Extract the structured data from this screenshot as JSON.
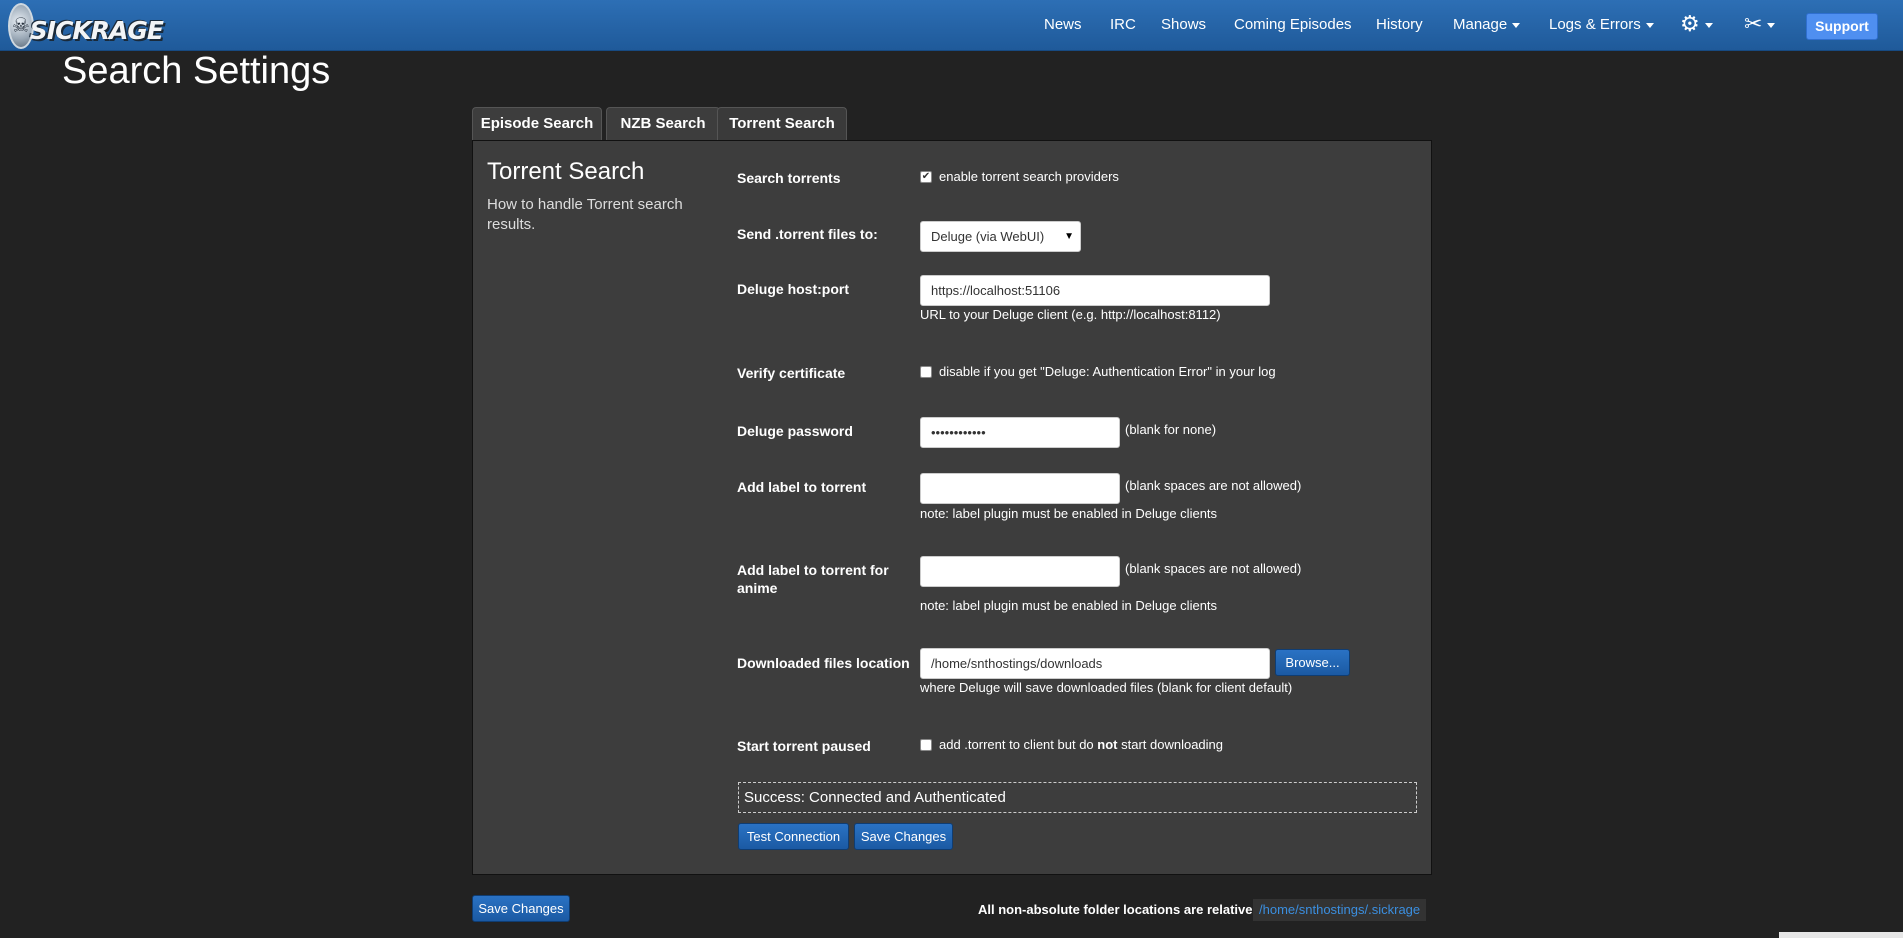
{
  "app": {
    "logo_text": "SICKRAGE",
    "page_title": "Search Settings"
  },
  "nav": {
    "items": [
      "News",
      "IRC",
      "Shows",
      "Coming Episodes",
      "History",
      "Manage",
      "Logs & Errors"
    ],
    "support": "Support",
    "icons": [
      "gear-icon",
      "tools-icon"
    ]
  },
  "tabs": [
    "Episode Search",
    "NZB Search",
    "Torrent Search"
  ],
  "section": {
    "title": "Torrent Search",
    "description": "How to handle Torrent search results."
  },
  "fields": {
    "search_torrents": {
      "label": "Search torrents",
      "checkbox_label": "enable torrent search providers",
      "checked": true
    },
    "send_to": {
      "label": "Send .torrent files to:",
      "value": "Deluge (via WebUI)"
    },
    "host": {
      "label": "Deluge host:port",
      "value": "https://localhost:51106",
      "help": "URL to your Deluge client (e.g. http://localhost:8112)"
    },
    "verify": {
      "label": "Verify certificate",
      "checkbox_label": "disable if you get \"Deluge: Authentication Error\" in your log",
      "checked": false
    },
    "password": {
      "label": "Deluge password",
      "value": "••••••••••••",
      "hint": "(blank for none)"
    },
    "label": {
      "label": "Add label to torrent",
      "value": "",
      "hint": "(blank spaces are not allowed)",
      "note": "note: label plugin must be enabled in Deluge clients"
    },
    "label_anime": {
      "label_line1": "Add label to torrent for",
      "label_line2": "anime",
      "value": "",
      "hint": "(blank spaces are not allowed)",
      "note": "note: label plugin must be enabled in Deluge clients"
    },
    "download_dir": {
      "label": "Downloaded files location",
      "value": "/home/snthostings/downloads",
      "browse": "Browse...",
      "help": "where Deluge will save downloaded files (blank for client default)"
    },
    "paused": {
      "label": "Start torrent paused",
      "text_before": "add .torrent to client but do ",
      "text_bold": "not",
      "text_after": " start downloading",
      "checked": false
    }
  },
  "status": "Success: Connected and Authenticated",
  "buttons": {
    "test": "Test Connection",
    "save": "Save Changes",
    "save_bottom": "Save Changes"
  },
  "footer": {
    "text": "All non-absolute folder locations are relative to",
    "path": "/home/snthostings/.sickrage"
  }
}
